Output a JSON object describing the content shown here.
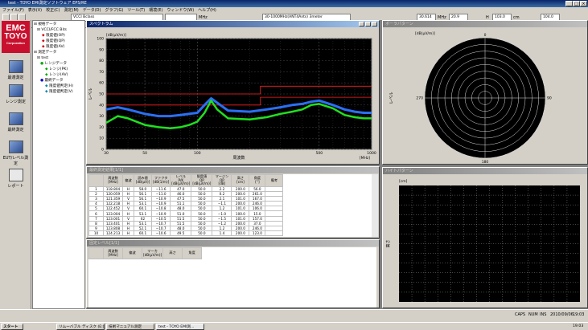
{
  "app": {
    "title": "test - TOYO EMI測定ソフトウェア EPS/RE"
  },
  "menu": [
    "ファイル(F)",
    "表示(V)",
    "校正(C)",
    "測定(M)",
    "データ(D)",
    "グラフ(G)",
    "ツール(T)",
    "環境(E)",
    "ウィンドウ(W)",
    "ヘルプ(H)"
  ],
  "toolbar": {
    "device": "VCCI Bclass",
    "freq_unit": "MHz",
    "antenna": "30-1000MHz(ANT4Ants) 3meter",
    "read1": "30.614",
    "read1_unit": "MHz",
    "read2": "20.9",
    "read3_label": "H",
    "read3": "103.0",
    "read3_unit": "cm",
    "read4": "104.0"
  },
  "logo": {
    "line1": "EMC",
    "line2": "TOYO",
    "line3": "Corporation"
  },
  "nav": [
    "最適測定",
    "レンジ測定",
    "最終測定",
    "EUT/レベル測定",
    "レポート"
  ],
  "tree": {
    "items": [
      {
        "t": "規格データ",
        "c": "#000"
      },
      {
        "t": "VCCI/FCC Bits",
        "c": "#000"
      },
      {
        "t": "限度値(OP)",
        "c": "#c00"
      },
      {
        "t": "限度値(QP)",
        "c": "#c00"
      },
      {
        "t": "限度値(AV)",
        "c": "#c00"
      },
      {
        "t": "測定データ",
        "c": "#000"
      },
      {
        "t": "test",
        "c": "#000"
      },
      {
        "t": "レンジデータ",
        "c": "#000"
      },
      {
        "t": "レンジ(PK)",
        "c": "#0a0"
      },
      {
        "t": "レンジ(AV)",
        "c": "#0a0"
      },
      {
        "t": "最終データ",
        "c": "#000"
      },
      {
        "t": "限度値判定(H)",
        "c": "#08a"
      },
      {
        "t": "限度値判定(V)",
        "c": "#08a"
      }
    ]
  },
  "spectrum": {
    "title": "スペクトラム",
    "ylabel": "レベル",
    "yunit": "[dB(μV/m)]",
    "xlabel": "周波数",
    "xunit": "[MHz]"
  },
  "radar": {
    "title": "ポーラパターン",
    "unit": "[dB(μV/m)]",
    "ylabel": "レベル",
    "t0": "0",
    "t90": "90",
    "t180": "180",
    "t270": "270"
  },
  "height": {
    "title": "ハイトパターン",
    "unit": "[cm]",
    "ylabel": "高さ"
  },
  "table": {
    "title": "最終測定結果[1/1]",
    "headers": [
      "",
      "周波数\n[MHz]",
      "偏波",
      "読み値\n[dB(μV)]",
      "ファクタ\n[dB(1/m)]",
      "レベル\nP/K\n[dB(μV/m)]",
      "限度値\nQP\n[dB(μV/m)]",
      "マージン\nQP\n[dB]",
      "高さ\n[cm]",
      "角度\n[°]",
      "備考"
    ],
    "rows": [
      [
        "1",
        "118.804",
        "H",
        "58.0",
        "−11.6",
        "47.0",
        "50.0",
        "2.2",
        "200.0",
        "56.0",
        ""
      ],
      [
        "2",
        "120.059",
        "H",
        "56.1",
        "−11.0",
        "46.0",
        "50.0",
        "0.2",
        "200.0",
        "261.0",
        ""
      ],
      [
        "3",
        "121.359",
        "V",
        "56.1",
        "−10.9",
        "47.5",
        "50.0",
        "2.1",
        "101.0",
        "167.0",
        ""
      ],
      [
        "4",
        "122.218",
        "H",
        "53.1",
        "−10.9",
        "51.1",
        "50.0",
        "−1.1",
        "200.0",
        "246.0",
        ""
      ],
      [
        "5",
        "122.452",
        "V",
        "60.1",
        "−10.8",
        "48.0",
        "50.0",
        "1.2",
        "101.0",
        "106.0",
        ""
      ],
      [
        "6",
        "123.004",
        "H",
        "53.1",
        "−10.9",
        "51.0",
        "50.0",
        "−1.0",
        "100.0",
        "15.0",
        ""
      ],
      [
        "7",
        "123.001",
        "V",
        "62",
        "−10.5",
        "51.5",
        "50.0",
        "−1.5",
        "101.0",
        "157.0",
        ""
      ],
      [
        "8",
        "123.401",
        "H",
        "53.1",
        "−10.7",
        "51.5",
        "50.0",
        "−1.2",
        "200.0",
        "37.0",
        ""
      ],
      [
        "9",
        "123.808",
        "H",
        "52.1",
        "−10.7",
        "48.0",
        "50.0",
        "1.2",
        "200.0",
        "246.0",
        ""
      ],
      [
        "10",
        "124.213",
        "H",
        "60.1",
        "−10.6",
        "49.5",
        "50.0",
        "1.4",
        "200.0",
        "123.0",
        ""
      ]
    ]
  },
  "level": {
    "title": "固定レベル[1/1]",
    "headers": [
      "周波数\n[MHz]",
      "偏波",
      "マーカ\n[dB(μV/m)]",
      "高さ",
      "角度"
    ]
  },
  "status": {
    "caps": "CAPS",
    "num": "NUM",
    "ins": "INS",
    "date": "2010/09/06",
    "time": "19:03"
  },
  "taskbar": {
    "start": "スタート",
    "tasks": [
      "リムーバブル ディスク (E:)",
      "技術マニュアル測定",
      "test - TOYO EMI測..."
    ],
    "clock": "19:03"
  },
  "chart_data": [
    {
      "type": "line",
      "title": "スペクトラム",
      "xlabel": "周波数",
      "ylabel": "レベル",
      "xscale": "log",
      "xlim": [
        30,
        1000
      ],
      "ylim": [
        0,
        100
      ],
      "x_ticks": [
        30,
        50,
        100,
        500,
        1000
      ],
      "y_ticks": [
        0,
        10,
        20,
        30,
        40,
        50,
        60,
        70,
        80,
        90,
        100
      ],
      "series": [
        {
          "name": "限度値(QP)",
          "color": "#ff2020",
          "x": [
            30,
            230,
            230,
            1000
          ],
          "y": [
            40,
            40,
            47,
            47
          ]
        },
        {
          "name": "限度値(OP)",
          "color": "#ff2020",
          "x": [
            30,
            230,
            230,
            1000
          ],
          "y": [
            50,
            50,
            57,
            57
          ]
        },
        {
          "name": "レンジ(PK)",
          "color": "#2a6ff5",
          "x": [
            30,
            35,
            40,
            50,
            60,
            70,
            80,
            90,
            100,
            110,
            120,
            130,
            150,
            200,
            250,
            300,
            350,
            400,
            450,
            500,
            600,
            700,
            800,
            900,
            1000
          ],
          "y": [
            36,
            38,
            36,
            32,
            30,
            30,
            31,
            32,
            33,
            40,
            46,
            42,
            35,
            34,
            36,
            38,
            40,
            41,
            43,
            44,
            40,
            36,
            34,
            33,
            33
          ]
        },
        {
          "name": "レンジ(AV)",
          "color": "#20e020",
          "x": [
            30,
            35,
            40,
            50,
            60,
            70,
            80,
            90,
            100,
            110,
            120,
            130,
            150,
            200,
            250,
            300,
            350,
            400,
            450,
            500,
            600,
            700,
            800,
            900,
            1000
          ],
          "y": [
            24,
            30,
            28,
            22,
            20,
            19,
            20,
            22,
            25,
            33,
            44,
            36,
            28,
            27,
            29,
            32,
            34,
            36,
            40,
            41,
            37,
            31,
            29,
            28,
            28
          ]
        }
      ]
    }
  ]
}
